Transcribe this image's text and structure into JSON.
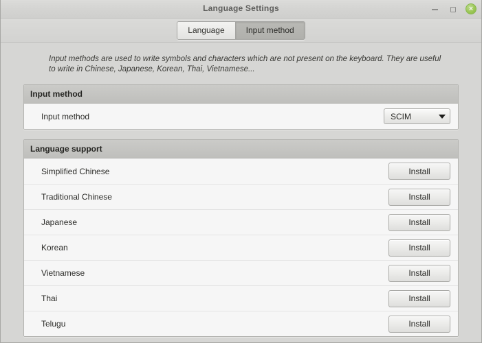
{
  "window": {
    "title": "Language Settings",
    "controls": {
      "minimize": "minimize",
      "maximize": "maximize",
      "close": "×"
    }
  },
  "tabs": [
    {
      "label": "Language",
      "active": false
    },
    {
      "label": "Input method",
      "active": true
    }
  ],
  "description": "Input methods are used to write symbols and characters which are not present on the keyboard. They are useful to write in Chinese, Japanese, Korean, Thai, Vietnamese...",
  "input_method_section": {
    "header": "Input method",
    "row_label": "Input method",
    "combo_value": "SCIM"
  },
  "language_support_section": {
    "header": "Language support",
    "install_label": "Install",
    "languages": [
      "Simplified Chinese",
      "Traditional Chinese",
      "Japanese",
      "Korean",
      "Vietnamese",
      "Thai",
      "Telugu"
    ]
  }
}
